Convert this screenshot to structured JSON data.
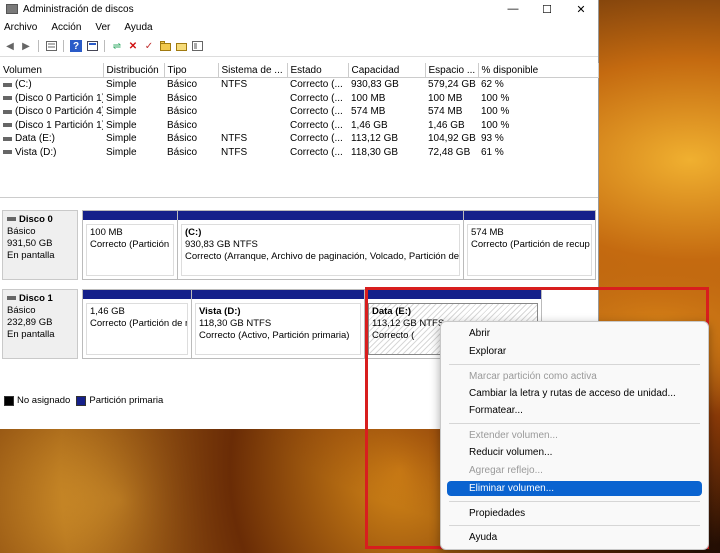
{
  "window": {
    "title": "Administración de discos",
    "controls": [
      "—",
      "☐",
      "✕"
    ]
  },
  "menu": [
    "Archivo",
    "Acción",
    "Ver",
    "Ayuda"
  ],
  "table": {
    "columns": [
      "Volumen",
      "Distribución",
      "Tipo",
      "Sistema de ...",
      "Estado",
      "Capacidad",
      "Espacio ...",
      "% disponible"
    ],
    "rows": [
      [
        "(C:)",
        "Simple",
        "Básico",
        "NTFS",
        "Correcto (...",
        "930,83 GB",
        "579,24 GB",
        "62 %"
      ],
      [
        "(Disco 0 Partición 1)",
        "Simple",
        "Básico",
        "",
        "Correcto (...",
        "100 MB",
        "100 MB",
        "100 %"
      ],
      [
        "(Disco 0 Partición 4)",
        "Simple",
        "Básico",
        "",
        "Correcto (...",
        "574 MB",
        "574 MB",
        "100 %"
      ],
      [
        "(Disco 1 Partición 1)",
        "Simple",
        "Básico",
        "",
        "Correcto (...",
        "1,46 GB",
        "1,46 GB",
        "100 %"
      ],
      [
        "Data (E:)",
        "Simple",
        "Básico",
        "NTFS",
        "Correcto (...",
        "113,12 GB",
        "104,92 GB",
        "93 %"
      ],
      [
        "Vista (D:)",
        "Simple",
        "Básico",
        "NTFS",
        "Correcto (...",
        "118,30 GB",
        "72,48 GB",
        "61 %"
      ]
    ]
  },
  "disk0": {
    "name": "Disco 0",
    "type": "Básico",
    "size": "931,50 GB",
    "status": "En pantalla",
    "p1": {
      "size": "100 MB",
      "status": "Correcto (Partición"
    },
    "p2": {
      "name": "(C:)",
      "size": "930,83 GB NTFS",
      "status": "Correcto (Arranque, Archivo de paginación, Volcado, Partición de"
    },
    "p3": {
      "size": "574 MB",
      "status": "Correcto (Partición de recup"
    }
  },
  "disk1": {
    "name": "Disco 1",
    "type": "Básico",
    "size": "232,89 GB",
    "status": "En pantalla",
    "p1": {
      "size": "1,46 GB",
      "status": "Correcto (Partición de r"
    },
    "p2": {
      "name": "Vista  (D:)",
      "size": "118,30 GB NTFS",
      "status": "Correcto (Activo, Partición primaria)"
    },
    "p3": {
      "name": "Data  (E:)",
      "size": "113,12 GB NTFS",
      "status": "Correcto ("
    }
  },
  "legend": {
    "unallocated": "No asignado",
    "primary": "Partición primaria"
  },
  "context_menu": {
    "abrir": "Abrir",
    "explorar": "Explorar",
    "marcar": "Marcar partición como activa",
    "cambiar": "Cambiar la letra y rutas de acceso de unidad...",
    "formatear": "Formatear...",
    "extender": "Extender volumen...",
    "reducir": "Reducir volumen...",
    "reflejo": "Agregar reflejo...",
    "eliminar": "Eliminar volumen...",
    "propiedades": "Propiedades",
    "ayuda": "Ayuda"
  },
  "colors": {
    "primary_partition": "#15208a",
    "highlight_box": "#d81e1e",
    "menu_selected": "#0a63d0"
  }
}
